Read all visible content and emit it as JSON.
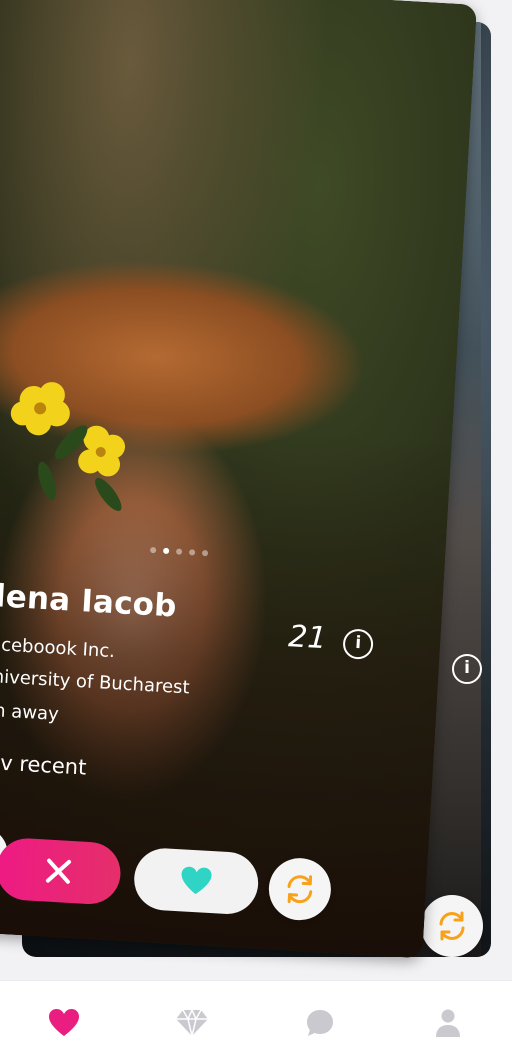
{
  "profile": {
    "name": "llena Iacob",
    "age": "21",
    "work": "Faceboook Inc.",
    "school": "University of Bucharest",
    "distance": "km away",
    "status": "ctiv recent",
    "photo_count": 5,
    "active_photo": 2
  },
  "icons": {
    "info": "info-icon",
    "nope": "close-icon",
    "like": "heart-icon",
    "refresh": "refresh-icon"
  },
  "colors": {
    "accent_pink": "#e91e80",
    "like_teal": "#2fd4c4",
    "refresh_orange": "#f7a21b",
    "nav_inactive": "#c9c9cf"
  },
  "nav": {
    "items": [
      "heart-icon",
      "diamond-icon",
      "chat-icon",
      "profile-icon"
    ],
    "active": "heart-icon"
  }
}
